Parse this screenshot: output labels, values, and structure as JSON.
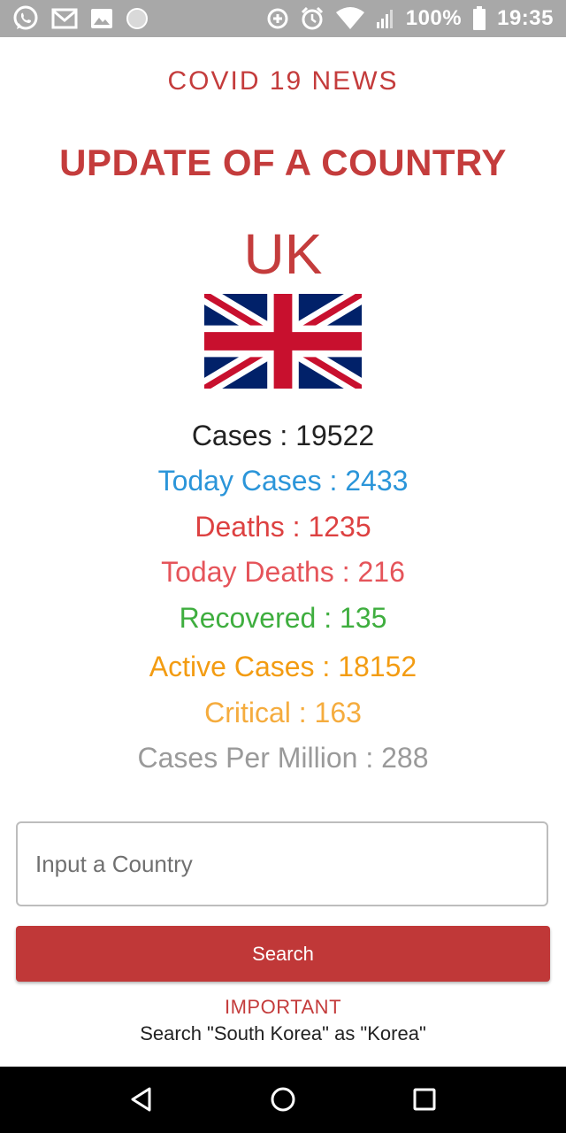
{
  "status_bar": {
    "battery_text": "100%",
    "time": "19:35",
    "left_icons": [
      "whatsapp-icon",
      "gmail-icon",
      "image-icon",
      "circle-icon"
    ],
    "right_icons": [
      "data-saver-icon",
      "alarm-icon",
      "wifi-icon",
      "signal-icon",
      "battery-icon"
    ]
  },
  "header": {
    "subtitle": "COVID 19 NEWS",
    "title": "UPDATE OF A COUNTRY"
  },
  "country": {
    "name": "UK",
    "flag_icon": "uk-flag-icon"
  },
  "stats": {
    "cases": "Cases : 19522",
    "today_cases": "Today Cases : 2433",
    "deaths": "Deaths : 1235",
    "today_deaths": "Today Deaths : 216",
    "recovered": "Recovered : 135",
    "active": "Active Cases : 18152",
    "critical": "Critical : 163",
    "per_million": "Cases Per Million : 288"
  },
  "colors": {
    "accent": "#c43c3c",
    "cases": "#222222",
    "today_cases": "#2b95d9",
    "deaths": "#dd4141",
    "today_deaths": "#e5545a",
    "recovered": "#3fae3f",
    "active": "#f39c12",
    "critical": "#f5ac3e",
    "per_million": "#9a9a9a"
  },
  "search": {
    "placeholder": "Input a Country",
    "button_label": "Search"
  },
  "footer": {
    "important_label": "IMPORTANT",
    "note": "Search \"South Korea\" as \"Korea\""
  },
  "nav_bar": {
    "icons": [
      "back-icon",
      "home-icon",
      "recents-icon"
    ]
  }
}
